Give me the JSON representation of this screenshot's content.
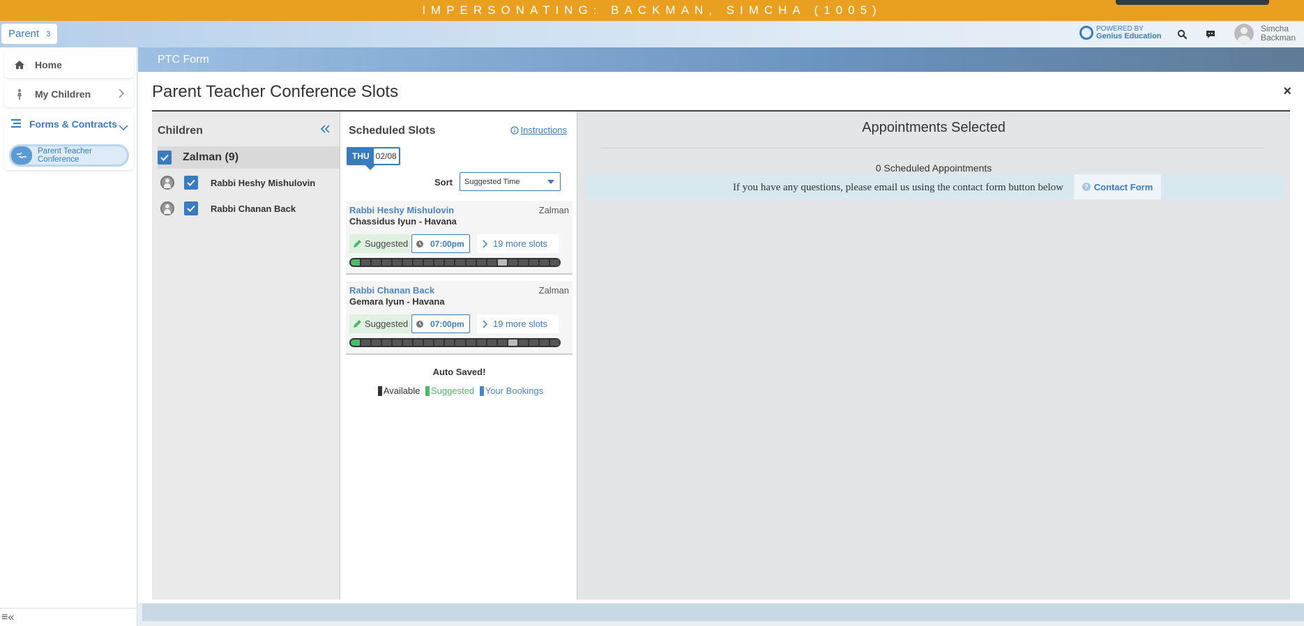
{
  "banner": {
    "text": "IMPERSONATING: BACKMAN, SIMCHA (1005)"
  },
  "topnav": {
    "role_label": "Parent",
    "role_count": "3",
    "powered_by": "POWERED BY",
    "powered_brand": "Genius Education",
    "user_first": "Simcha",
    "user_last": "Backman"
  },
  "sidebar": {
    "home": "Home",
    "my_children": "My Children",
    "forms_contracts": "Forms & Contracts",
    "ptc_line1": "Parent Teacher",
    "ptc_line2": "Conference",
    "collapse": "≡«"
  },
  "header_bar": {
    "title": "PTC Form"
  },
  "page": {
    "title": "Parent Teacher Conference Slots",
    "close": "×"
  },
  "children_panel": {
    "title": "Children",
    "child": "Zalman (9)",
    "teachers": [
      "Rabbi Heshy Mishulovin",
      "Rabbi Chanan Back"
    ]
  },
  "slots_panel": {
    "title": "Scheduled Slots",
    "instructions": "Instructions",
    "day": "THU",
    "date": "02/08",
    "sort_label": "Sort",
    "sort_value": "Suggested Time",
    "cards": [
      {
        "teacher": "Rabbi Heshy Mishulovin",
        "child": "Zalman",
        "course": "Chassidus Iyun - Havana",
        "status": "Suggested",
        "time": "07:00pm",
        "more": "19 more slots"
      },
      {
        "teacher": "Rabbi Chanan Back",
        "child": "Zalman",
        "course": "Gemara Iyun - Havana",
        "status": "Suggested",
        "time": "07:00pm",
        "more": "19 more slots"
      }
    ],
    "auto_saved": "Auto Saved!",
    "legend": {
      "available": "Available",
      "suggested": "Suggested",
      "bookings": "Your Bookings"
    }
  },
  "appointments": {
    "title": "Appointments Selected",
    "count": "0 Scheduled Appointments",
    "info": "If you have any questions, please email us using the contact form button below",
    "contact_button": "Contact Form"
  },
  "colors": {
    "banner": "#e9a020",
    "accent": "#3a7bbf",
    "suggested": "#4cbb6c",
    "available": "#333333"
  }
}
